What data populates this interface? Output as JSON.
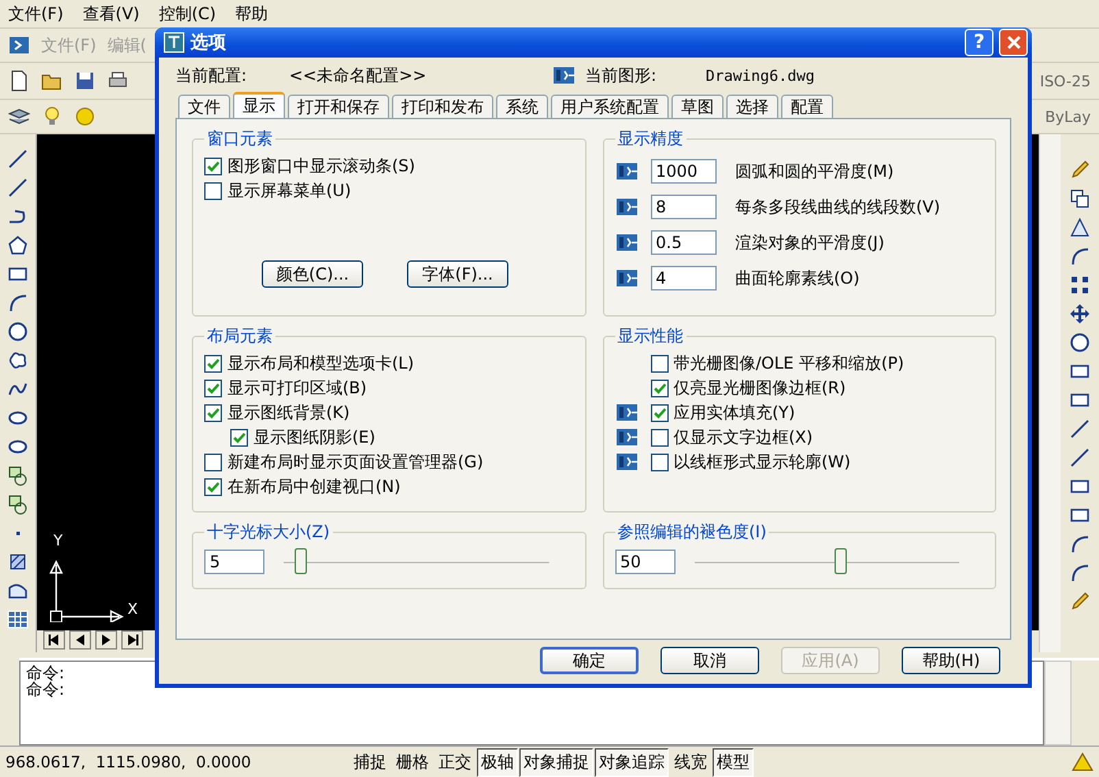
{
  "menu_bar": [
    {
      "label": "文件(F)"
    },
    {
      "label": "查看(V)"
    },
    {
      "label": "控制(C)"
    },
    {
      "label": "帮助"
    }
  ],
  "background_toolbar": {
    "menus": [
      "文件(F)",
      "编辑("
    ],
    "dimension_style": "ISO-25",
    "linetype": "ByLay"
  },
  "canvas": {
    "y_axis": "Y",
    "x_axis": "X"
  },
  "command_lines": [
    "命令:",
    "命令:"
  ],
  "status_bar": {
    "coordinates": "968.0617,  1115.0980,  0.0000",
    "toggles": [
      {
        "label": "捕捉",
        "on": false
      },
      {
        "label": "栅格",
        "on": false
      },
      {
        "label": "正交",
        "on": false
      },
      {
        "label": "极轴",
        "on": true
      },
      {
        "label": "对象捕捉",
        "on": true
      },
      {
        "label": "对象追踪",
        "on": true
      },
      {
        "label": "线宽",
        "on": false
      },
      {
        "label": "模型",
        "on": true
      }
    ]
  },
  "dialog": {
    "title": "选项",
    "help_glyph": "?",
    "current_profile_label": "当前配置:",
    "current_profile": "<<未命名配置>>",
    "current_drawing_label": "当前图形:",
    "current_drawing": "Drawing6.dwg",
    "tabs": [
      {
        "label": "文件",
        "selected": false
      },
      {
        "label": "显示",
        "selected": true
      },
      {
        "label": "打开和保存",
        "selected": false
      },
      {
        "label": "打印和发布",
        "selected": false
      },
      {
        "label": "系统",
        "selected": false
      },
      {
        "label": "用户系统配置",
        "selected": false
      },
      {
        "label": "草图",
        "selected": false
      },
      {
        "label": "选择",
        "selected": false
      },
      {
        "label": "配置",
        "selected": false
      }
    ],
    "window_elements": {
      "title": "窗口元素",
      "checkboxes": [
        {
          "label": "图形窗口中显示滚动条(S)",
          "checked": true
        },
        {
          "label": "显示屏幕菜单(U)",
          "checked": false
        }
      ],
      "buttons": [
        "颜色(C)...",
        "字体(F)..."
      ]
    },
    "layout_elements": {
      "title": "布局元素",
      "checkboxes": [
        {
          "label": "显示布局和模型选项卡(L)",
          "checked": true
        },
        {
          "label": "显示可打印区域(B)",
          "checked": true
        },
        {
          "label": "显示图纸背景(K)",
          "checked": true,
          "children": [
            {
              "label": "显示图纸阴影(E)",
              "checked": true
            }
          ]
        },
        {
          "label": "新建布局时显示页面设置管理器(G)",
          "checked": false
        },
        {
          "label": "在新布局中创建视口(N)",
          "checked": true
        }
      ]
    },
    "crosshair_size": {
      "title": "十字光标大小(Z)",
      "value": "5",
      "level": 0.06
    },
    "display_resolution": {
      "title": "显示精度",
      "rows": [
        {
          "value": "1000",
          "label": "圆弧和圆的平滑度(M)"
        },
        {
          "value": "8",
          "label": "每条多段线曲线的线段数(V)"
        },
        {
          "value": "0.5",
          "label": "渲染对象的平滑度(J)"
        },
        {
          "value": "4",
          "label": "曲面轮廓素线(O)"
        }
      ]
    },
    "display_performance": {
      "title": "显示性能",
      "checkboxes": [
        {
          "label": "带光栅图像/OLE 平移和缩放(P)",
          "checked": false,
          "icon": false
        },
        {
          "label": "仅亮显光栅图像边框(R)",
          "checked": true,
          "icon": false
        },
        {
          "label": "应用实体填充(Y)",
          "checked": true,
          "icon": true
        },
        {
          "label": "仅显示文字边框(X)",
          "checked": false,
          "icon": true
        },
        {
          "label": "以线框形式显示轮廓(W)",
          "checked": false,
          "icon": true
        }
      ]
    },
    "xref_fading": {
      "title": "参照编辑的褪色度(I)",
      "value": "50",
      "level": 0.55
    },
    "buttons": [
      {
        "label": "确定",
        "disabled": false,
        "default": true
      },
      {
        "label": "取消",
        "disabled": false,
        "default": false
      },
      {
        "label": "应用(A)",
        "disabled": true,
        "default": false
      },
      {
        "label": "帮助(H)",
        "disabled": false,
        "default": false
      }
    ]
  }
}
